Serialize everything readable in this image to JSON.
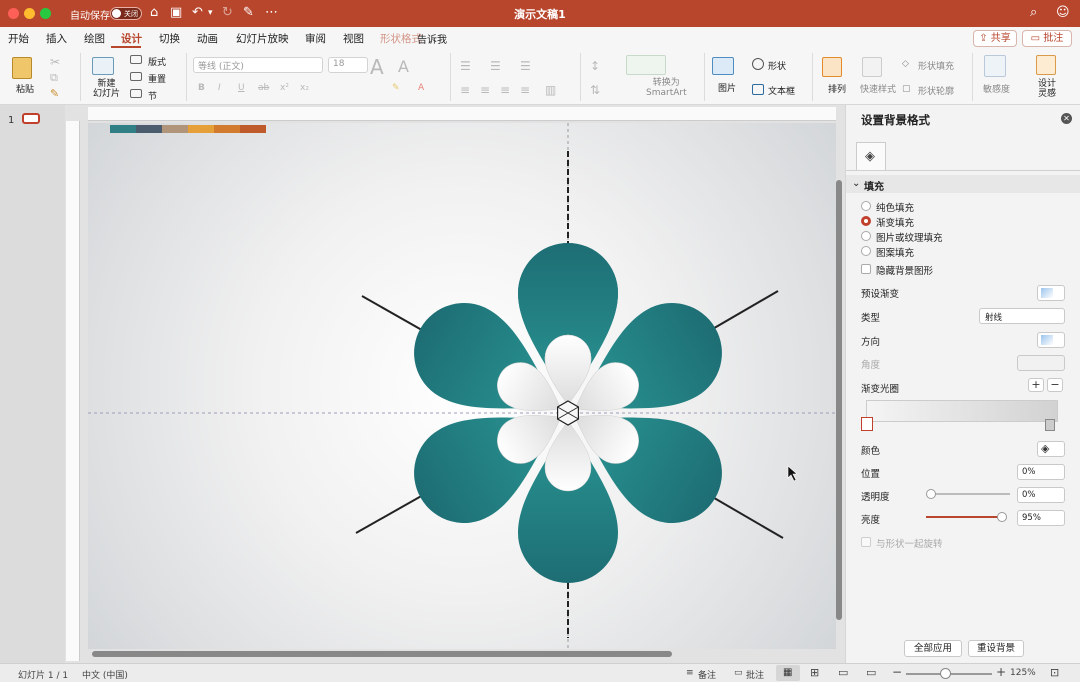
{
  "titlebar": {
    "autosave_label": "自动保存",
    "autosave_state": "关闭",
    "doc_title": "演示文稿1"
  },
  "menu": {
    "items": [
      "开始",
      "插入",
      "绘图",
      "设计",
      "切换",
      "动画",
      "幻灯片放映",
      "审阅",
      "视图",
      "形状格式",
      "告诉我"
    ],
    "active_index": 3,
    "share": "共享",
    "comment": "批注"
  },
  "ribbon": {
    "paste": "粘贴",
    "new_slide": "新建\n幻灯片",
    "layout": "版式",
    "reset": "重置",
    "section": "节",
    "font_name": "等线 (正文)",
    "font_size": "18",
    "convert_smartart": "转换为\nSmartArt",
    "picture": "图片",
    "shapes": "形状",
    "textbox": "文本框",
    "arrange": "排列",
    "quick_styles": "快速样式",
    "shape_fill": "形状填充",
    "shape_outline": "形状轮廓",
    "sensitivity": "敏感度",
    "design_ideas": "设计\n灵感"
  },
  "slides_pane": {
    "slide_number": "1"
  },
  "panel": {
    "title": "设置背景格式",
    "section_fill": "填充",
    "fill_options": [
      "纯色填充",
      "渐变填充",
      "图片或纹理填充",
      "图案填充"
    ],
    "selected_fill_index": 1,
    "hide_bg_graphics": "隐藏背景图形",
    "preset_gradient": "预设渐变",
    "type_label": "类型",
    "type_value": "射线",
    "direction_label": "方向",
    "angle_label": "角度",
    "gradient_stops_label": "渐变光圈",
    "color_label": "颜色",
    "position_label": "位置",
    "position_value": "0%",
    "transparency_label": "透明度",
    "transparency_value": "0%",
    "brightness_label": "亮度",
    "brightness_value": "95%",
    "brightness_level": 0.95,
    "rotate_with_shape": "与形状一起旋转",
    "apply_all": "全部应用",
    "reset_bg": "重设背景"
  },
  "statusbar": {
    "slide_info": "幻灯片 1 / 1",
    "language": "中文 (中国)",
    "notes": "备注",
    "comments": "批注",
    "zoom": "125%"
  },
  "colors": {
    "accent": "#b8462d",
    "petal_teal": "#1f8a8a",
    "palette_strip": [
      "#2f7f84",
      "#4a5c6e",
      "#b0957a",
      "#e5a03a",
      "#d27b2e",
      "#bf5a2a"
    ]
  }
}
